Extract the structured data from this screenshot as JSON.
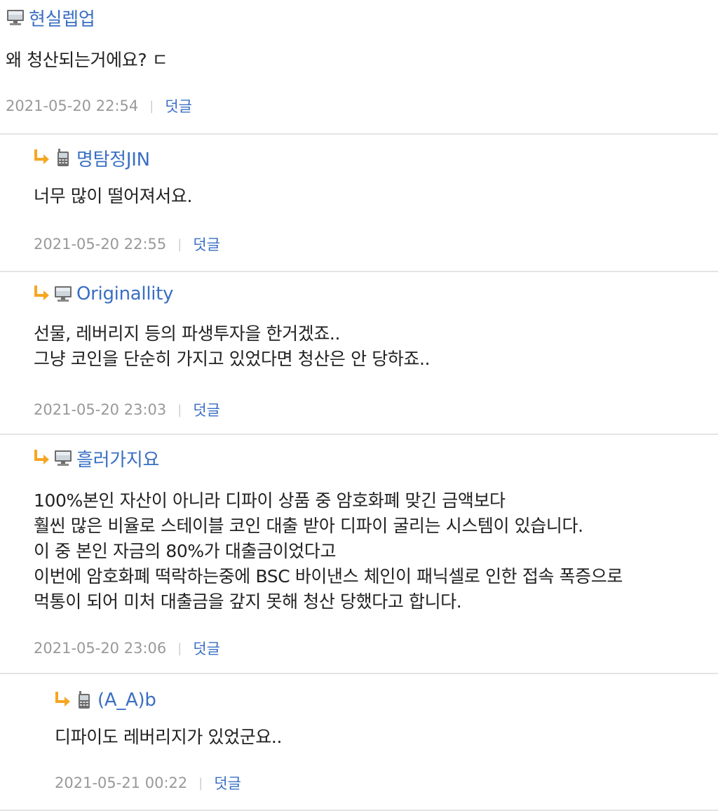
{
  "comments": [
    {
      "author": "현실렙업",
      "device": "pc-icon",
      "lines": [
        "왜 청산되는거에요? ㄷ"
      ],
      "date": "2021-05-20 22:54",
      "reply_label": "덧글"
    },
    {
      "author": "명탐정JIN",
      "device": "phone-icon",
      "lines": [
        "너무 많이 떨어져서요."
      ],
      "date": "2021-05-20 22:55",
      "reply_label": "덧글"
    },
    {
      "author": "Originallity",
      "device": "pc-icon",
      "lines": [
        "선물, 레버리지 등의 파생투자을 한거겠죠..",
        "그냥 코인을 단순히 가지고 있었다면 청산은 안 당하죠.."
      ],
      "date": "2021-05-20 23:03",
      "reply_label": "덧글"
    },
    {
      "author": "흘러가지요",
      "device": "pc-icon",
      "lines": [
        "100%본인 자산이 아니라 디파이 상품 중 암호화폐 맞긴 금액보다",
        "훨씬 많은 비율로 스테이블 코인 대출 받아 디파이 굴리는 시스템이 있습니다.",
        "이 중 본인 자금의 80%가 대출금이었다고",
        "이번에 암호화폐 떡락하는중에 BSC 바이낸스 체인이 패닉셀로 인한 접속 폭증으로",
        "먹통이 되어 미처 대출금을 갚지 못해 청산 당했다고 합니다."
      ],
      "date": "2021-05-20 23:06",
      "reply_label": "덧글"
    },
    {
      "author": "(A_A)b",
      "device": "phone-icon",
      "lines": [
        "디파이도 레버리지가 있었군요.."
      ],
      "date": "2021-05-21 00:22",
      "reply_label": "덧글"
    }
  ],
  "colors": {
    "author": "#3a6fc3",
    "meta": "#999999",
    "arrow": "#f5a623",
    "divider": "#e4e4e4"
  }
}
